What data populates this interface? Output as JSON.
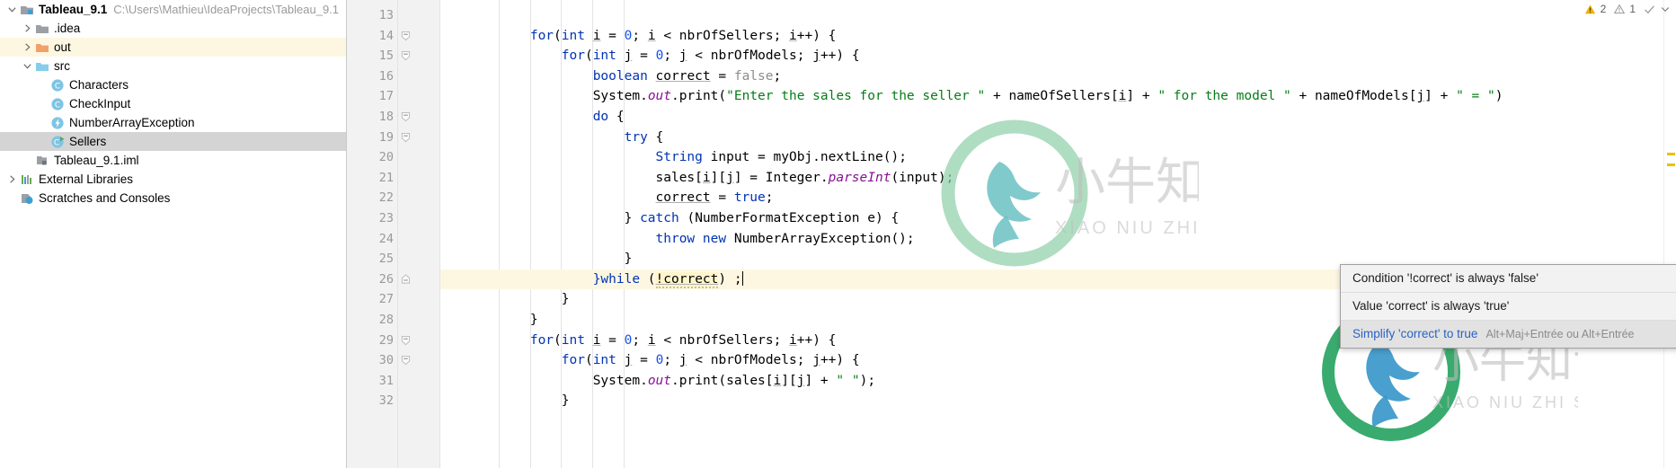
{
  "project": {
    "tree": [
      {
        "indent": 0,
        "twisty": "expanded",
        "icon": "project-module-icon",
        "label": "Tableau_9.1",
        "bold": true,
        "path": "C:\\Users\\Mathieu\\IdeaProjects\\Tableau_9.1",
        "highlight": "none"
      },
      {
        "indent": 1,
        "twisty": "collapsed",
        "icon": "folder-grey-icon",
        "label": ".idea",
        "bold": false,
        "path": "",
        "highlight": "none"
      },
      {
        "indent": 1,
        "twisty": "collapsed",
        "icon": "folder-orange-icon",
        "label": "out",
        "bold": false,
        "path": "",
        "highlight": "yellow"
      },
      {
        "indent": 1,
        "twisty": "expanded",
        "icon": "folder-blue-icon",
        "label": "src",
        "bold": false,
        "path": "",
        "highlight": "none"
      },
      {
        "indent": 2,
        "twisty": "none",
        "icon": "java-class-icon",
        "label": "Characters",
        "bold": false,
        "path": "",
        "highlight": "none"
      },
      {
        "indent": 2,
        "twisty": "none",
        "icon": "java-class-icon",
        "label": "CheckInput",
        "bold": false,
        "path": "",
        "highlight": "none"
      },
      {
        "indent": 2,
        "twisty": "none",
        "icon": "java-exception-icon",
        "label": "NumberArrayException",
        "bold": false,
        "path": "",
        "highlight": "none"
      },
      {
        "indent": 2,
        "twisty": "none",
        "icon": "java-runnable-class-icon",
        "label": "Sellers",
        "bold": false,
        "path": "",
        "highlight": "gray"
      },
      {
        "indent": 1,
        "twisty": "none",
        "icon": "iml-file-icon",
        "label": "Tableau_9.1.iml",
        "bold": false,
        "path": "",
        "highlight": "none"
      },
      {
        "indent": 0,
        "twisty": "collapsed",
        "icon": "external-libraries-icon",
        "label": "External Libraries",
        "bold": false,
        "path": "",
        "highlight": "none"
      },
      {
        "indent": 0,
        "twisty": "none",
        "icon": "scratches-icon",
        "label": "Scratches and Consoles",
        "bold": false,
        "path": "",
        "highlight": "none"
      }
    ]
  },
  "editor": {
    "first_line_number": 13,
    "highlighted_line": 26,
    "lines": [
      {
        "n": 13,
        "fold": "none",
        "indent": 0,
        "text": ""
      },
      {
        "n": 14,
        "fold": "open",
        "indent": 2,
        "text": "for(int i = 0; i < nbrOfSellers; i++) {"
      },
      {
        "n": 15,
        "fold": "open",
        "indent": 3,
        "text": "for(int j = 0; j < nbrOfModels; j++) {"
      },
      {
        "n": 16,
        "fold": "none",
        "indent": 4,
        "text": "boolean correct = false;"
      },
      {
        "n": 17,
        "fold": "none",
        "indent": 4,
        "text": "System.out.print(\"Enter the sales for the seller \" + nameOfSellers[i] + \" for the model \" + nameOfModels[j] + \" = \")"
      },
      {
        "n": 18,
        "fold": "open",
        "indent": 4,
        "text": "do {"
      },
      {
        "n": 19,
        "fold": "open",
        "indent": 5,
        "text": "try {"
      },
      {
        "n": 20,
        "fold": "none",
        "indent": 6,
        "text": "String input = myObj.nextLine();"
      },
      {
        "n": 21,
        "fold": "none",
        "indent": 6,
        "text": "sales[i][j] = Integer.parseInt(input);"
      },
      {
        "n": 22,
        "fold": "none",
        "indent": 6,
        "text": "correct = true;"
      },
      {
        "n": 23,
        "fold": "none",
        "indent": 5,
        "text": "} catch (NumberFormatException e) {"
      },
      {
        "n": 24,
        "fold": "none",
        "indent": 6,
        "text": "throw new NumberArrayException();"
      },
      {
        "n": 25,
        "fold": "none",
        "indent": 5,
        "text": "}"
      },
      {
        "n": 26,
        "fold": "closed",
        "indent": 4,
        "text": "}while (!correct) ;"
      },
      {
        "n": 27,
        "fold": "none",
        "indent": 3,
        "text": "}"
      },
      {
        "n": 28,
        "fold": "none",
        "indent": 2,
        "text": "}"
      },
      {
        "n": 29,
        "fold": "open",
        "indent": 2,
        "text": "for(int i = 0; i < nbrOfSellers; i++) {"
      },
      {
        "n": 30,
        "fold": "open",
        "indent": 3,
        "text": "for(int j = 0; j < nbrOfModels; j++) {"
      },
      {
        "n": 31,
        "fold": "none",
        "indent": 4,
        "text": "System.out.print(sales[i][j] + \" \");"
      },
      {
        "n": 32,
        "fold": "none",
        "indent": 3,
        "text": "}"
      }
    ]
  },
  "status": {
    "error_icon": "warning-triangle-icon",
    "error_count": "2",
    "warning_icon": "warning-triangle-small-icon",
    "warning_count": "1",
    "ok_icon": "checkmark-icon",
    "chevron_icon": "chevron-down-icon"
  },
  "popup": {
    "items": [
      {
        "label": "Condition '!correct' is always 'false'",
        "shortcut": "",
        "state": "normal",
        "kebab": true
      },
      {
        "label": "Value 'correct' is always 'true'",
        "shortcut": "",
        "state": "normal",
        "kebab": false
      },
      {
        "label": "Simplify 'correct' to true",
        "shortcut": "Alt+Maj+Entrée  ou  Alt+Entrée",
        "state": "selected",
        "kebab": false
      }
    ]
  },
  "watermark": {
    "title_cn": "小牛知识库",
    "subtitle": "XIAO NIU ZHI SHI KU"
  },
  "colors": {
    "keyword": "#0033b3",
    "string": "#067d17",
    "number": "#1750eb",
    "field": "#871094",
    "selection_gray": "#d4d4d4",
    "highlight_yellow": "#fdf7e2",
    "accent_link": "#2a62c4"
  }
}
